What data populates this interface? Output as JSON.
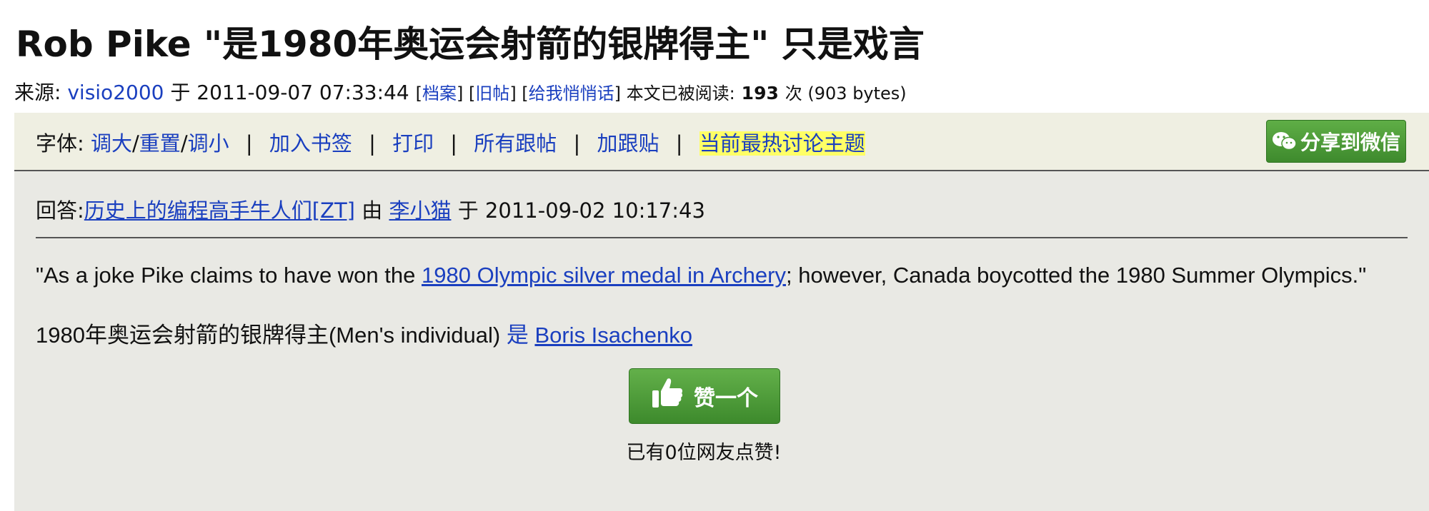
{
  "title": "Rob Pike \"是1980年奥运会射箭的银牌得主\" 只是戏言",
  "meta": {
    "source_label": "来源:",
    "author": "visio2000",
    "date_prefix": "于",
    "datetime": "2011-09-07 07:33:44",
    "archive_link": "档案",
    "old_posts_link": "旧帖",
    "whisper_link": "给我悄悄话",
    "read_label": "本文已被阅读:",
    "read_count": "193",
    "read_suffix": "次 (903 bytes)"
  },
  "toolbar": {
    "font_label": "字体:",
    "enlarge": "调大",
    "reset": "重置",
    "shrink": "调小",
    "bookmark": "加入书签",
    "print": "打印",
    "all_followups": "所有跟帖",
    "add_followup": "加跟贴",
    "hot_topics": "当前最热讨论主题",
    "share_wechat": "分享到微信"
  },
  "reply": {
    "prefix": "回答:",
    "thread_title": "历史上的编程高手牛人们[ZT]",
    "by": "由",
    "author": "李小猫",
    "at": "于",
    "datetime": "2011-09-02 10:17:43"
  },
  "body": {
    "para1_before": "\"As a joke Pike claims to have won the ",
    "para1_link": "1980 Olympic silver medal in Archery",
    "para1_after": "; however, Canada boycotted the 1980 Summer Olympics.\"",
    "para2_before": "1980年奥运会射箭的银牌得主(Men's individual) ",
    "para2_shi": "是",
    "para2_link": "Boris Isachenko"
  },
  "like": {
    "button_label": "赞一个",
    "count_text": "已有0位网友点赞!"
  },
  "icons": {
    "wechat": "wechat-icon",
    "thumbs_up": "thumbs-up-icon"
  },
  "colors": {
    "link": "#1a3fbf",
    "toolbar_bg": "#efefe2",
    "content_bg": "#e9e9e4",
    "button_green": "#4f9e3a",
    "highlight": "#ffff66"
  }
}
